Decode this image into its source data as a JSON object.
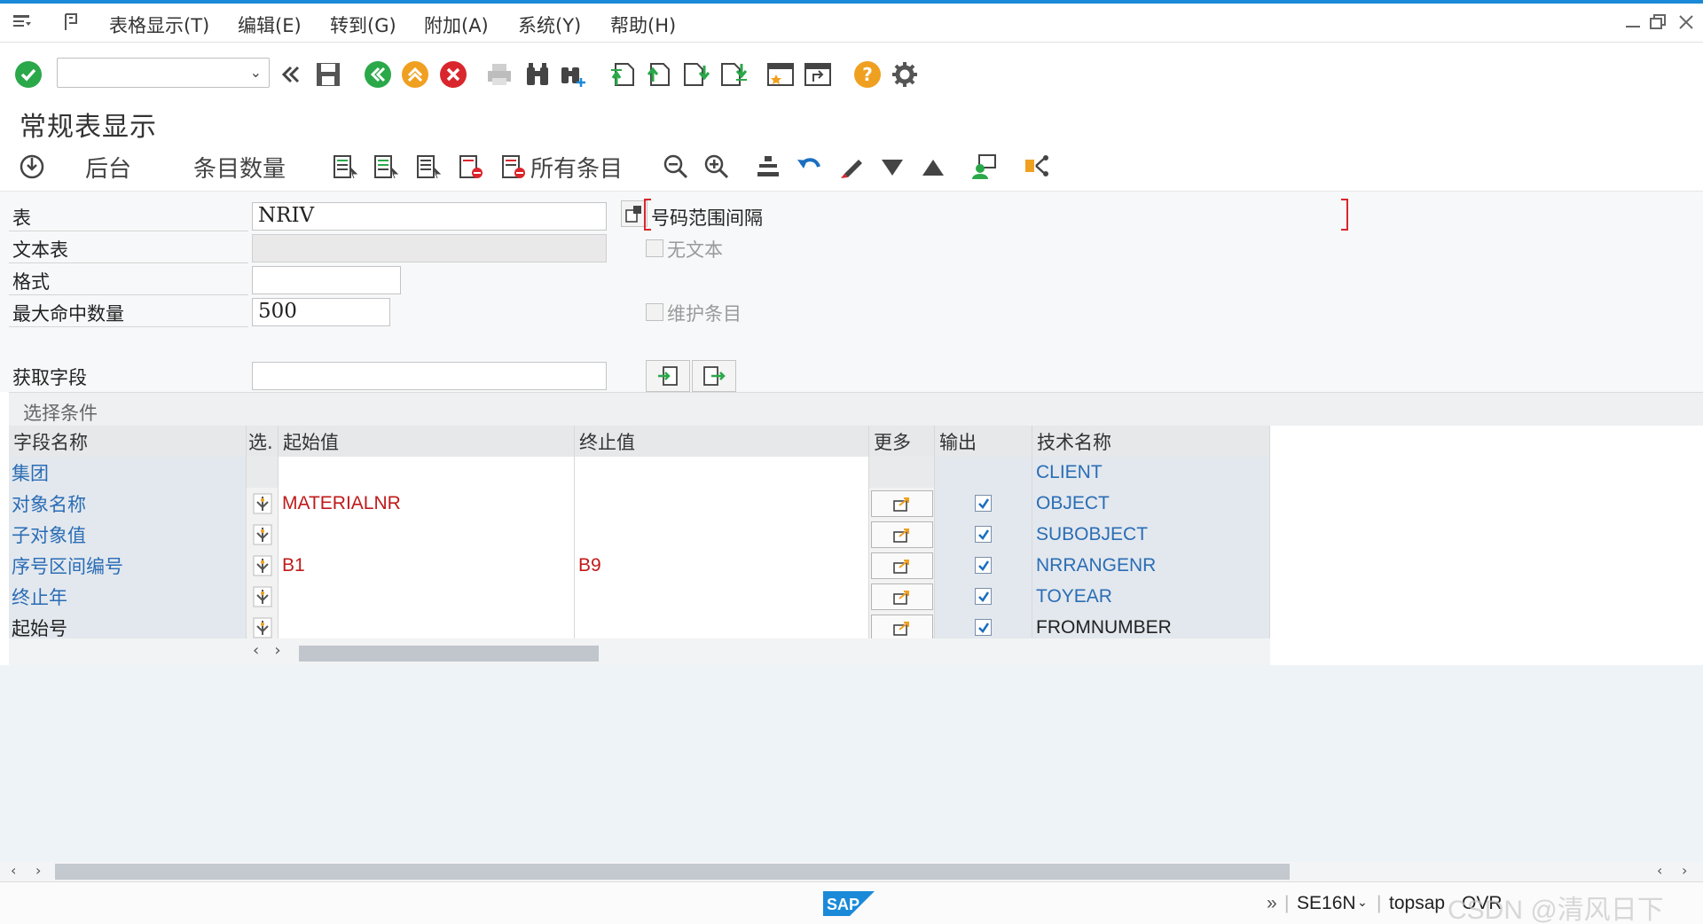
{
  "menu": {
    "items": [
      "表格显示(T)",
      "编辑(E)",
      "转到(G)",
      "附加(A)",
      "系统(Y)",
      "帮助(H)"
    ]
  },
  "toolbar": {
    "command_value": ""
  },
  "page": {
    "title": "常规表显示"
  },
  "app_toolbar": {
    "background_label": "后台",
    "entry_count_label": "条目数量",
    "all_entries_label": "所有条目"
  },
  "form": {
    "table_label": "表",
    "table_value": "NRIV",
    "text_table_label": "文本表",
    "text_table_value": "",
    "layout_label": "格式",
    "layout_value": "",
    "max_hits_label": "最大命中数量",
    "max_hits_value": "500",
    "get_fields_label": "获取字段",
    "get_fields_value": "",
    "table_description": "号码范围间隔",
    "no_text_label": "无文本",
    "maintain_entries_label": "维护条目"
  },
  "selection": {
    "header": "选择条件",
    "columns": {
      "field_name": "字段名称",
      "sel": "选.",
      "from": "起始值",
      "to": "终止值",
      "more": "更多",
      "output": "输出",
      "tech_name": "技术名称"
    },
    "rows": [
      {
        "name": "集团",
        "from": "",
        "to": "",
        "output": false,
        "tech": "CLIENT"
      },
      {
        "name": "对象名称",
        "from": "MATERIALNR",
        "to": "",
        "output": true,
        "tech": "OBJECT"
      },
      {
        "name": "子对象值",
        "from": "",
        "to": "",
        "output": true,
        "tech": "SUBOBJECT"
      },
      {
        "name": "序号区间编号",
        "from": "B1",
        "to": "B9",
        "output": true,
        "tech": "NRRANGENR"
      },
      {
        "name": "终止年",
        "from": "",
        "to": "",
        "output": true,
        "tech": "TOYEAR"
      },
      {
        "name": "起始号",
        "from": "",
        "to": "",
        "output": true,
        "tech": "FROMNUMBER"
      }
    ]
  },
  "status": {
    "transaction": "SE16N",
    "system": "topsap",
    "mode": "OVR",
    "watermark": "CSDN @清风日下"
  },
  "colors": {
    "accent": "#1a8ad8",
    "green": "#2aa84a",
    "orange": "#f0a020",
    "red": "#d9262c",
    "link_blue": "#2a6db5",
    "value_red": "#c01a1a"
  }
}
